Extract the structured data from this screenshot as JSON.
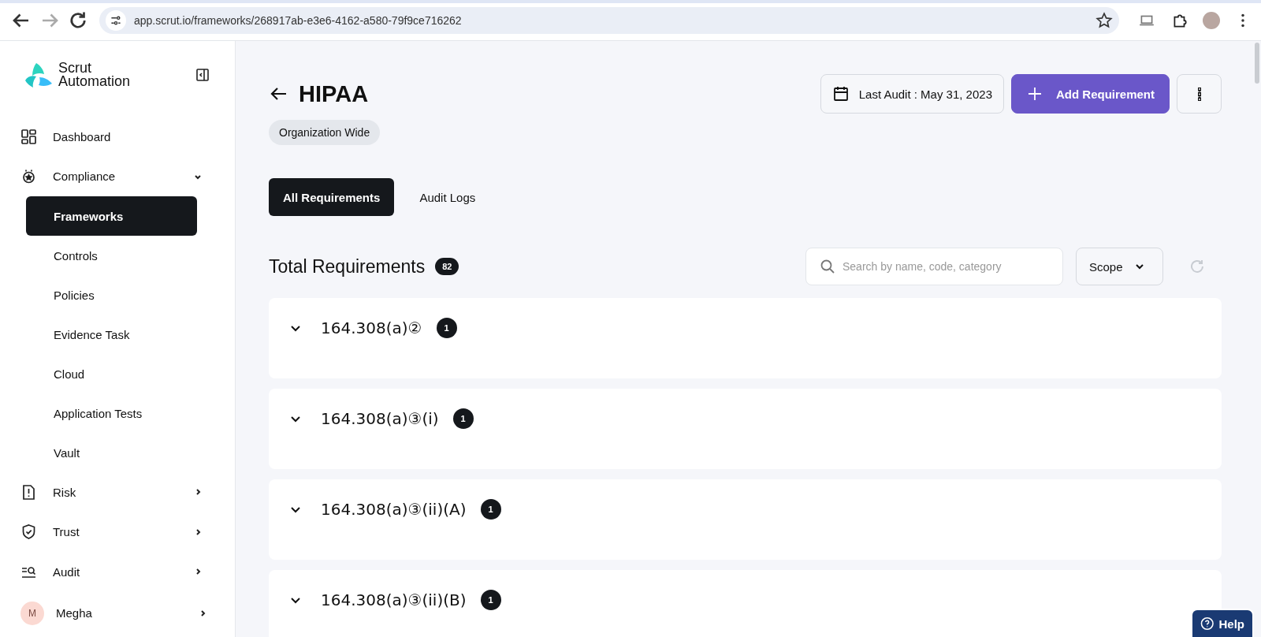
{
  "browser": {
    "url": "app.scrut.io/frameworks/268917ab-e3e6-4162-a580-79f9ce716262"
  },
  "sidebar": {
    "brand": [
      "Scrut",
      "Automation"
    ],
    "items": [
      {
        "label": "Dashboard",
        "kind": "link"
      },
      {
        "label": "Compliance",
        "kind": "section",
        "expanded": true
      },
      {
        "label": "Frameworks",
        "kind": "subitem",
        "selected": true
      },
      {
        "label": "Controls",
        "kind": "subitem",
        "selected": false
      },
      {
        "label": "Policies",
        "kind": "subitem",
        "selected": false
      },
      {
        "label": "Evidence Task",
        "kind": "subitem",
        "selected": false
      },
      {
        "label": "Cloud",
        "kind": "subitem",
        "selected": false
      },
      {
        "label": "Application Tests",
        "kind": "subitem",
        "selected": false
      },
      {
        "label": "Vault",
        "kind": "subitem",
        "selected": false
      },
      {
        "label": "Risk",
        "kind": "section",
        "expanded": false
      },
      {
        "label": "Trust",
        "kind": "section",
        "expanded": false
      },
      {
        "label": "Audit",
        "kind": "section",
        "expanded": false
      }
    ],
    "user": {
      "initial": "M",
      "name": "Megha"
    }
  },
  "header": {
    "title": "HIPAA",
    "scope_tag": "Organization Wide",
    "last_audit": "Last Audit : May 31, 2023",
    "add_button": "Add Requirement"
  },
  "tabs": [
    {
      "label": "All Requirements",
      "selected": true
    },
    {
      "label": "Audit Logs",
      "selected": false
    }
  ],
  "requirements": {
    "title": "Total Requirements",
    "count": "82",
    "search": {
      "placeholder": "Search by name, code, category"
    },
    "scope_filter": "Scope",
    "rows": [
      {
        "code": "164.308(a)②",
        "count": "1"
      },
      {
        "code": "164.308(a)③(i)",
        "count": "1"
      },
      {
        "code": "164.308(a)③(ii)(A)",
        "count": "1"
      },
      {
        "code": "164.308(a)③(ii)(B)",
        "count": "1"
      }
    ]
  },
  "help_button": "Help"
}
